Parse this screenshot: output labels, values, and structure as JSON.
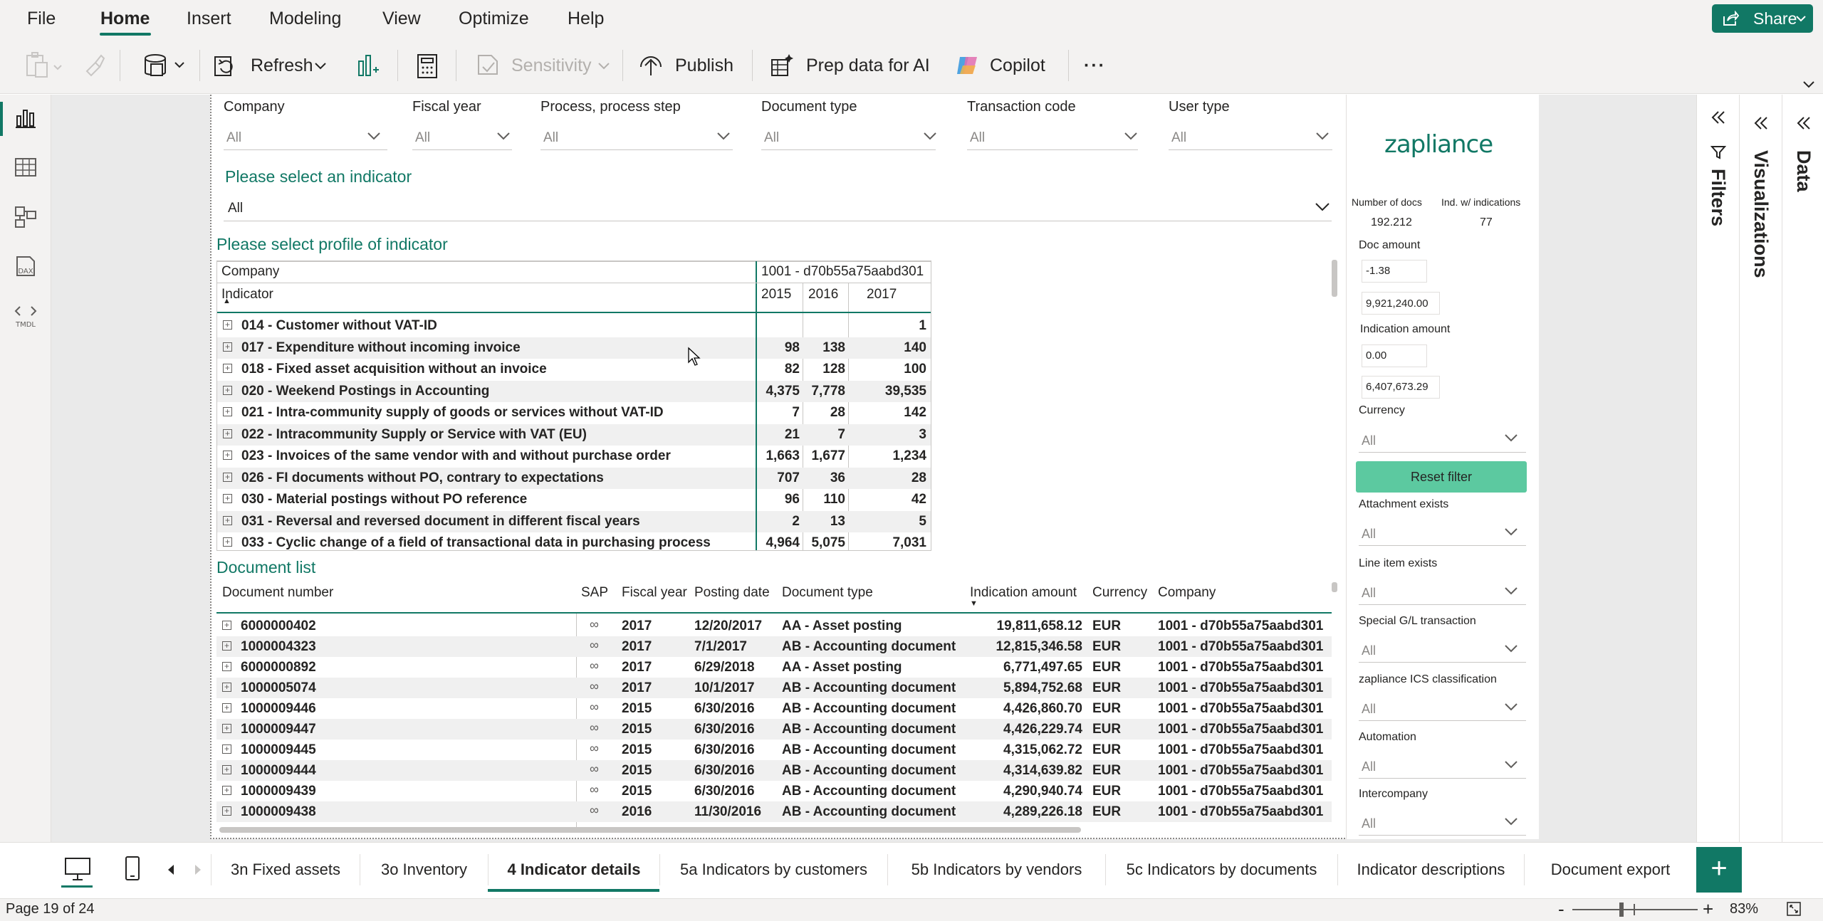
{
  "menu": {
    "items": [
      "File",
      "Home",
      "Insert",
      "Modeling",
      "View",
      "Optimize",
      "Help"
    ],
    "active": "Home",
    "share_label": "Share"
  },
  "ribbon": {
    "refresh": "Refresh",
    "sensitivity": "Sensitivity",
    "publish": "Publish",
    "prep_ai": "Prep data for AI",
    "copilot": "Copilot",
    "more": "···"
  },
  "slicers": [
    {
      "title": "Company",
      "value": "All"
    },
    {
      "title": "Fiscal year",
      "value": "All"
    },
    {
      "title": "Process, process step",
      "value": "All"
    },
    {
      "title": "Document type",
      "value": "All"
    },
    {
      "title": "Transaction code",
      "value": "All"
    },
    {
      "title": "User type",
      "value": "All"
    }
  ],
  "indicator_select": {
    "title": "Please select an indicator",
    "value": "All"
  },
  "profile": {
    "title": "Please select profile of indicator",
    "company_label": "Company",
    "company_value": "1001 - d70b55a75aabd301",
    "indicator_label": "Indicator",
    "years": [
      "2015",
      "2016",
      "2017"
    ],
    "rows": [
      {
        "name": "014 - Customer without VAT-ID",
        "v": [
          "",
          "",
          "1"
        ]
      },
      {
        "name": "017 - Expenditure without incoming invoice",
        "v": [
          "98",
          "138",
          "140"
        ]
      },
      {
        "name": "018 - Fixed asset acquisition without an invoice",
        "v": [
          "82",
          "128",
          "100"
        ]
      },
      {
        "name": "020 - Weekend Postings in Accounting",
        "v": [
          "4,375",
          "7,778",
          "39,535"
        ]
      },
      {
        "name": "021 - Intra-community supply of goods or services without VAT-ID",
        "v": [
          "7",
          "28",
          "142"
        ]
      },
      {
        "name": "022 - Intracommunity Supply or Service with VAT (EU)",
        "v": [
          "21",
          "7",
          "3"
        ]
      },
      {
        "name": "023 - Invoices of the same vendor with and without purchase order",
        "v": [
          "1,663",
          "1,677",
          "1,234"
        ]
      },
      {
        "name": "026 - FI documents without PO, contrary to expectations",
        "v": [
          "707",
          "36",
          "28"
        ]
      },
      {
        "name": "030 - Material postings without PO reference",
        "v": [
          "96",
          "110",
          "42"
        ]
      },
      {
        "name": "031 - Reversal and reversed document in different fiscal years",
        "v": [
          "2",
          "13",
          "5"
        ]
      },
      {
        "name": "033 - Cyclic change of a field of transactional data in purchasing process",
        "v": [
          "4,964",
          "5,075",
          "7,031"
        ]
      }
    ]
  },
  "doclist": {
    "title": "Document list",
    "headers": [
      "Document number",
      "SAP",
      "Fiscal year",
      "Posting date",
      "Document type",
      "Indication amount",
      "Currency",
      "Company"
    ],
    "rows": [
      [
        "6000000402",
        "2017",
        "12/20/2017",
        "AA - Asset posting",
        "19,811,658.12",
        "EUR",
        "1001 - d70b55a75aabd301"
      ],
      [
        "1000004323",
        "2017",
        "7/1/2017",
        "AB - Accounting document",
        "12,815,346.58",
        "EUR",
        "1001 - d70b55a75aabd301"
      ],
      [
        "6000000892",
        "2017",
        "6/29/2018",
        "AA - Asset posting",
        "6,771,497.65",
        "EUR",
        "1001 - d70b55a75aabd301"
      ],
      [
        "1000005074",
        "2017",
        "10/1/2017",
        "AB - Accounting document",
        "5,894,752.68",
        "EUR",
        "1001 - d70b55a75aabd301"
      ],
      [
        "1000009446",
        "2015",
        "6/30/2016",
        "AB - Accounting document",
        "4,426,860.70",
        "EUR",
        "1001 - d70b55a75aabd301"
      ],
      [
        "1000009447",
        "2015",
        "6/30/2016",
        "AB - Accounting document",
        "4,426,229.74",
        "EUR",
        "1001 - d70b55a75aabd301"
      ],
      [
        "1000009445",
        "2015",
        "6/30/2016",
        "AB - Accounting document",
        "4,315,062.72",
        "EUR",
        "1001 - d70b55a75aabd301"
      ],
      [
        "1000009444",
        "2015",
        "6/30/2016",
        "AB - Accounting document",
        "4,314,639.82",
        "EUR",
        "1001 - d70b55a75aabd301"
      ],
      [
        "1000009439",
        "2015",
        "6/30/2016",
        "AB - Accounting document",
        "4,290,940.74",
        "EUR",
        "1001 - d70b55a75aabd301"
      ],
      [
        "1000009438",
        "2016",
        "11/30/2016",
        "AB - Accounting document",
        "4,289,226.18",
        "EUR",
        "1001 - d70b55a75aabd301"
      ]
    ]
  },
  "right_panel": {
    "logo": "zapliance",
    "num_docs_label": "Number of docs",
    "num_docs_value": "192.212",
    "ind_label": "Ind. w/ indications",
    "ind_value": "77",
    "doc_amount_label": "Doc amount",
    "doc_amount_min": "-1.38",
    "doc_amount_max": "9,921,240.00",
    "ind_amount_label": "Indication amount",
    "ind_amount_min": "0.00",
    "ind_amount_max": "6,407,673.29",
    "currency_label": "Currency",
    "currency_value": "All",
    "reset_label": "Reset filter",
    "filters": [
      {
        "title": "Attachment exists",
        "value": "All"
      },
      {
        "title": "Line item exists",
        "value": "All"
      },
      {
        "title": "Special G/L transaction",
        "value": "All"
      },
      {
        "title": "zapliance ICS classification",
        "value": "All"
      },
      {
        "title": "Automation",
        "value": "All"
      },
      {
        "title": "Intercompany",
        "value": "All"
      }
    ]
  },
  "panes": {
    "filters": "Filters",
    "visualizations": "Visualizations",
    "data": "Data"
  },
  "tabs": [
    "3n Fixed assets",
    "3o Inventory",
    "4 Indicator details",
    "5a Indicators by customers",
    "5b Indicators by vendors",
    "5c Indicators by documents",
    "Indicator descriptions",
    "Document export"
  ],
  "active_tab": "4 Indicator details",
  "status": {
    "page": "Page 19 of 24",
    "zoom": "83%"
  },
  "colors": {
    "accent": "#117865",
    "reset": "#5cc9a0"
  }
}
